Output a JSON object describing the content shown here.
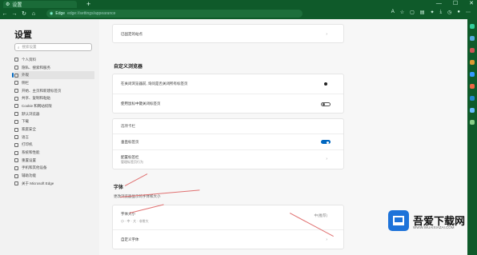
{
  "browser": {
    "tab_title": "设置",
    "url": "edge://settings/appearance",
    "url_label": "Edge",
    "plus": "+",
    "controls": {
      "minimize": "—",
      "maximize": "☐",
      "close": "✕"
    }
  },
  "sidebar": {
    "title": "设置",
    "search_placeholder": "搜索设置",
    "items": [
      {
        "label": "个人资料",
        "active": false
      },
      {
        "label": "隐私、搜索和服务",
        "active": false
      },
      {
        "label": "外观",
        "active": true
      },
      {
        "label": "侧栏",
        "active": false
      },
      {
        "label": "开始、主页和新建标签页",
        "active": false
      },
      {
        "label": "共享、复制和粘贴",
        "active": false
      },
      {
        "label": "Cookie 和网站权限",
        "active": false
      },
      {
        "label": "默认浏览器",
        "active": false
      },
      {
        "label": "下载",
        "active": false
      },
      {
        "label": "家庭安全",
        "active": false
      },
      {
        "label": "语言",
        "active": false
      },
      {
        "label": "打印机",
        "active": false
      },
      {
        "label": "系统和性能",
        "active": false
      },
      {
        "label": "重置设置",
        "active": false
      },
      {
        "label": "手机和其他设备",
        "active": false
      },
      {
        "label": "辅助功能",
        "active": false
      },
      {
        "label": "关于 Microsoft Edge",
        "active": false
      }
    ]
  },
  "main": {
    "top_card_row": "已固定的站点",
    "custom_browser_title": "自定义浏览器",
    "browser_rows": [
      {
        "label": "在关闭浏览器前, 询问是否关闭所有标签页",
        "control": "radio"
      },
      {
        "label": "使用鼠标中键关闭标签页",
        "control": "toggle_off"
      }
    ],
    "tabs_card": {
      "title": "选项卡栏",
      "rows": [
        {
          "label": "垂直标签页",
          "control": "toggle_on"
        },
        {
          "label": "配置标签栏",
          "sub": "管理标签页行为",
          "control": "chevron"
        }
      ]
    },
    "fonts": {
      "title": "字体",
      "description": "更改浏览器显示的字体和大小",
      "size_label": "字体大小",
      "size_sub": "小  ·  中  ·  大  ·  非常大",
      "size_value": "中(推荐)",
      "custom_label": "自定义字体"
    }
  },
  "watermark": {
    "title": "吾爱下载网",
    "url": "WWW.WUAIXIAZAI.COM"
  },
  "colors": {
    "frame": "#0f5a2a",
    "accent": "#0067c0",
    "annotation": "#e07070"
  },
  "icons": [
    "back-icon",
    "forward-icon",
    "refresh-icon",
    "home-icon",
    "search-icon",
    "settings-icon"
  ]
}
